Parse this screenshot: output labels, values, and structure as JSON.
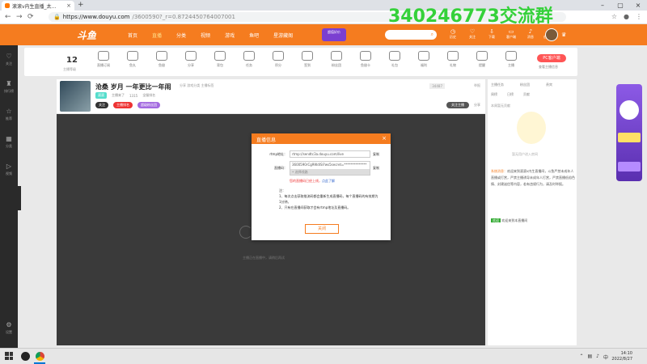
{
  "browser": {
    "tab_title": "滚滚v内生直播_太...",
    "url_host": "https://www.douyu.com",
    "url_path": "/3600590?_r=0.8724450764007001",
    "watermark": "340246773交流群"
  },
  "header": {
    "logo": "斗鱼",
    "nav": [
      "首页",
      "直播",
      "分类",
      "视频",
      "游戏",
      "鱼吧",
      "星游藏阁"
    ],
    "promo": "超值好价",
    "search_placeholder": "",
    "icons": [
      "历史",
      "关注",
      "下载",
      "客户端",
      "消息",
      "创作中心"
    ]
  },
  "sidebar": {
    "items": [
      "关注",
      "排行榜",
      "推荐",
      "分类",
      "视频"
    ],
    "bottom": "设置"
  },
  "giftbar": {
    "level": "12",
    "level_sub": "主播等级",
    "items": [
      "直播订阅",
      "鱼丸",
      "鱼翅",
      "分享",
      "背包",
      "任务",
      "积分",
      "签到",
      "粉丝团",
      "鱼翅卡",
      "礼包",
      "福利",
      "礼物",
      "提醒",
      "主播"
    ],
    "pc_button": "PC客户端",
    "pc_sub": "查看主播信息"
  },
  "streamer": {
    "title": "沧桑 岁月 一年更比一年闹",
    "tags": "分享  游戏分类  主播标签",
    "meta": [
      "滚滚",
      "主播来了",
      "1315",
      "全服排名"
    ],
    "badges": [
      "关注",
      "主播排名",
      "超级粉丝团"
    ],
    "count": "34487",
    "report": "举报",
    "follow": "关注主播",
    "share": "分享"
  },
  "video": {
    "hint": "主播正在直播中，请稍后再试"
  },
  "chat": {
    "tabs": [
      "主播任务",
      "粉丝团",
      "贵宾"
    ],
    "rank": [
      "周榜",
      "日榜",
      "贡献"
    ],
    "sub": "本周暂无贡献",
    "empty": "暂无用户进入房间",
    "msg_name": "系统消息：",
    "msg_text": "欢迎来到滚滚v内生直播间，斗鱼严禁未成年人直播或打赏，严禁主播诱导未成年人打赏，严禁直播低俗色情、封建迷信等内容，若有违规行为，请及时举报。",
    "msg2_tag": "欢迎",
    "msg2_text": "欢迎来到本直播间"
  },
  "modal": {
    "title": "直播信息",
    "close": "×",
    "rtmp_label": "rtmp地址：",
    "rtmp_value": "rtmp://sendtc3a.douyu.com/live",
    "copy": "复制",
    "code_label": "直播码：",
    "code_value": "3600590rCg9WdlSI?ws5secret=**************",
    "code_select": "• 选择线路",
    "warning": "您的直播码已经上线，",
    "warning_link": "点此了解",
    "notes_title": "注：",
    "notes": [
      "1、每次点击获取推流码都会重新生成直播码，每个直播码的有效期为1分钟。",
      "2、只有在直播间获取才会有rtmp地址及直播码。"
    ],
    "ok_button": "关闭"
  },
  "taskbar": {
    "time": "14:10",
    "date": "2022/8/27"
  }
}
